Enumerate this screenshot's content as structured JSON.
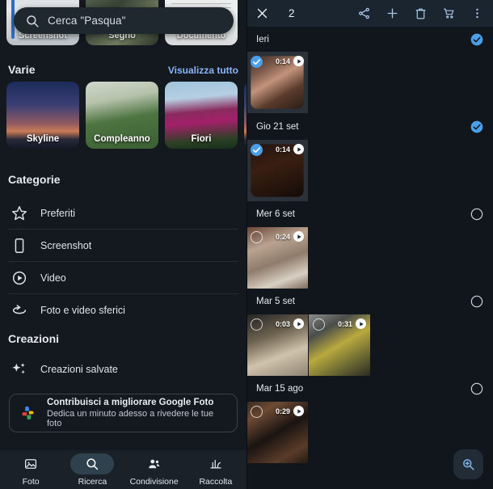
{
  "left_pane": {
    "search": {
      "placeholder": "Cerca \"Pasqua\"",
      "icon": "search-icon"
    },
    "top_cards": [
      {
        "label": "Screenshot",
        "icon": "screenshot-thumb"
      },
      {
        "label": "Segno",
        "icon": "sign-thumb"
      },
      {
        "label": "Documento",
        "icon": "document-thumb"
      }
    ],
    "varie": {
      "title": "Varie",
      "action": "Visualizza tutto",
      "cards": [
        {
          "label": "Skyline"
        },
        {
          "label": "Compleanno"
        },
        {
          "label": "Fiori"
        }
      ]
    },
    "categorie": {
      "title": "Categorie",
      "items": [
        {
          "label": "Preferiti",
          "icon": "star-icon"
        },
        {
          "label": "Screenshot",
          "icon": "phone-icon"
        },
        {
          "label": "Video",
          "icon": "play-circle-icon"
        },
        {
          "label": "Foto e video sferici",
          "icon": "panorama-sphere-icon"
        }
      ]
    },
    "creazioni": {
      "title": "Creazioni",
      "items": [
        {
          "label": "Creazioni salvate",
          "icon": "sparkle-icon"
        }
      ]
    },
    "promo": {
      "icon": "google-photos-hand-icon",
      "title": "Contribuisci a migliorare Google Foto",
      "subtitle": "Dedica un minuto adesso a rivedere le tue foto"
    },
    "bottom_nav": [
      {
        "label": "Foto",
        "icon": "photo-icon",
        "active": false
      },
      {
        "label": "Ricerca",
        "icon": "search-icon",
        "active": true
      },
      {
        "label": "Condivisione",
        "icon": "people-icon",
        "active": false
      },
      {
        "label": "Raccolta",
        "icon": "library-icon",
        "active": false
      }
    ]
  },
  "right_pane": {
    "selection_bar": {
      "close_icon": "close-icon",
      "count": "2",
      "actions": [
        {
          "icon": "share-icon",
          "name": "share-button"
        },
        {
          "icon": "plus-icon",
          "name": "add-to-button"
        },
        {
          "icon": "trash-icon",
          "name": "delete-button"
        },
        {
          "icon": "cart-icon",
          "name": "cart-button"
        },
        {
          "icon": "more-vert-icon",
          "name": "more-options-button"
        }
      ]
    },
    "groups": [
      {
        "title": "Ieri",
        "selected": true,
        "items": [
          {
            "duration": "0:14",
            "selected": true,
            "kind": "video",
            "thumb": "th-guitar"
          }
        ]
      },
      {
        "title": "Gio 21 set",
        "selected": true,
        "items": [
          {
            "duration": "0:14",
            "selected": true,
            "kind": "video",
            "thumb": "th-dark"
          }
        ]
      },
      {
        "title": "Mer 6 set",
        "selected": false,
        "items": [
          {
            "duration": "0:24",
            "selected": false,
            "kind": "video",
            "thumb": "th-floor"
          }
        ]
      },
      {
        "title": "Mar 5 set",
        "selected": false,
        "items": [
          {
            "duration": "0:03",
            "selected": false,
            "kind": "video",
            "thumb": "th-water"
          },
          {
            "duration": "0:31",
            "selected": false,
            "kind": "video",
            "thumb": "th-bag"
          }
        ]
      },
      {
        "title": "Mar 15 ago",
        "selected": false,
        "items": [
          {
            "duration": "0:29",
            "selected": false,
            "kind": "video",
            "thumb": "th-room"
          }
        ]
      }
    ],
    "fab": {
      "icon": "lens-zoom-icon"
    }
  },
  "colors": {
    "background": "#14181f",
    "panel_background": "#11161d",
    "accent_blue": "#8ab4f8",
    "selection_blue": "#4a9fe8",
    "selection_bar": "#1b2530",
    "nav_bar": "#1b2128"
  }
}
